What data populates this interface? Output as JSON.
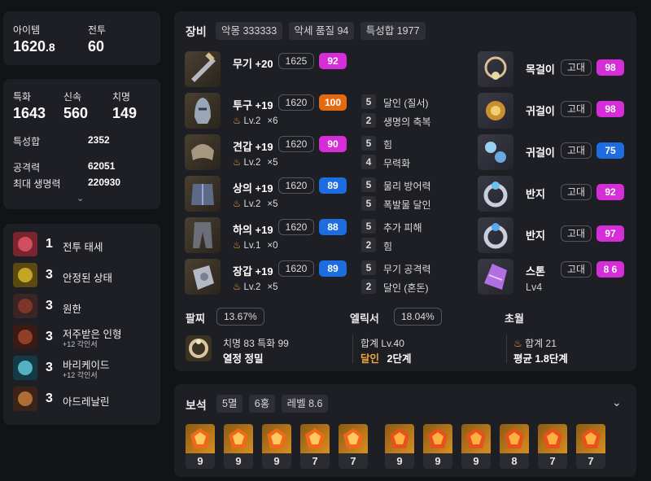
{
  "summary": {
    "item_label": "아이템",
    "item_value": "1620",
    "item_decimal": ".8",
    "combat_label": "전투",
    "combat_value": "60"
  },
  "stats": {
    "crit_label": "특화",
    "crit_value": "1643",
    "swift_label": "신속",
    "swift_value": "560",
    "chi_label": "치명",
    "chi_value": "149",
    "total_label": "특성합",
    "total_value": "2352",
    "atk_label": "공격력",
    "atk_value": "62051",
    "hp_label": "최대 생명력",
    "hp_value": "220930"
  },
  "engravings": [
    {
      "num": "1",
      "name": "전투 태세",
      "sub": ""
    },
    {
      "num": "3",
      "name": "안정된 상태",
      "sub": ""
    },
    {
      "num": "3",
      "name": "원한",
      "sub": ""
    },
    {
      "num": "3",
      "name": "저주받은 인형",
      "sub": "+12 각인서"
    },
    {
      "num": "3",
      "name": "바리케이드",
      "sub": "+12 각인서"
    },
    {
      "num": "3",
      "name": "아드레날린",
      "sub": ""
    }
  ],
  "equipment": {
    "title": "장비",
    "tags": [
      "악몽 333333",
      "악세 품질 94",
      "특성합 1977"
    ],
    "left": [
      {
        "name": "무기 +20",
        "level": "1625",
        "quality": "92",
        "color": "#d52ed8",
        "lv": "",
        "mult": "",
        "opts": []
      },
      {
        "name": "투구 +19",
        "level": "1620",
        "quality": "100",
        "color": "#e46a12",
        "lv": "Lv.2",
        "mult": "×6",
        "opts": [
          {
            "n": "5",
            "t": "달인 (질서)"
          },
          {
            "n": "2",
            "t": "생명의 축복"
          }
        ]
      },
      {
        "name": "견갑 +19",
        "level": "1620",
        "quality": "90",
        "color": "#d52ed8",
        "lv": "Lv.2",
        "mult": "×5",
        "opts": [
          {
            "n": "5",
            "t": "힘"
          },
          {
            "n": "4",
            "t": "무력화"
          }
        ]
      },
      {
        "name": "상의 +19",
        "level": "1620",
        "quality": "89",
        "color": "#1d6de0",
        "lv": "Lv.2",
        "mult": "×5",
        "opts": [
          {
            "n": "5",
            "t": "물리 방어력"
          },
          {
            "n": "5",
            "t": "폭발물 달인"
          }
        ]
      },
      {
        "name": "하의 +19",
        "level": "1620",
        "quality": "88",
        "color": "#1d6de0",
        "lv": "Lv.1",
        "mult": "×0",
        "opts": [
          {
            "n": "5",
            "t": "추가 피해"
          },
          {
            "n": "2",
            "t": "힘"
          }
        ]
      },
      {
        "name": "장갑 +19",
        "level": "1620",
        "quality": "89",
        "color": "#1d6de0",
        "lv": "Lv.2",
        "mult": "×5",
        "opts": [
          {
            "n": "5",
            "t": "무기 공격력"
          },
          {
            "n": "2",
            "t": "달인 (혼돈)"
          }
        ]
      }
    ],
    "right": [
      {
        "name": "목걸이",
        "grade": "고대",
        "quality": "98",
        "color": "#d52ed8"
      },
      {
        "name": "귀걸이",
        "grade": "고대",
        "quality": "98",
        "color": "#d52ed8"
      },
      {
        "name": "귀걸이",
        "grade": "고대",
        "quality": "75",
        "color": "#1d6de0"
      },
      {
        "name": "반지",
        "grade": "고대",
        "quality": "92",
        "color": "#d52ed8"
      },
      {
        "name": "반지",
        "grade": "고대",
        "quality": "97",
        "color": "#d52ed8"
      },
      {
        "name": "스톤",
        "grade": "고대",
        "quality": "8 6",
        "color": "#d52ed8",
        "sub": "Lv4"
      }
    ],
    "bracelet": {
      "title": "팔찌",
      "pct": "13.67%",
      "line1": "치명 83  특화 99",
      "line2": "열정  정밀"
    },
    "elixir": {
      "title": "엘릭서",
      "pct": "18.04%",
      "line1": "합계 Lv.40",
      "line2a": "달인",
      "line2b": "2단계"
    },
    "transcend": {
      "title": "초월",
      "line1": "합계 21",
      "line2": "평균 1.8단계"
    }
  },
  "gems": {
    "title": "보석",
    "tags": [
      "5멸",
      "6홍",
      "레벨 8.6"
    ],
    "items": [
      "9",
      "9",
      "9",
      "7",
      "7",
      "9",
      "9",
      "9",
      "8",
      "7",
      "7"
    ]
  }
}
